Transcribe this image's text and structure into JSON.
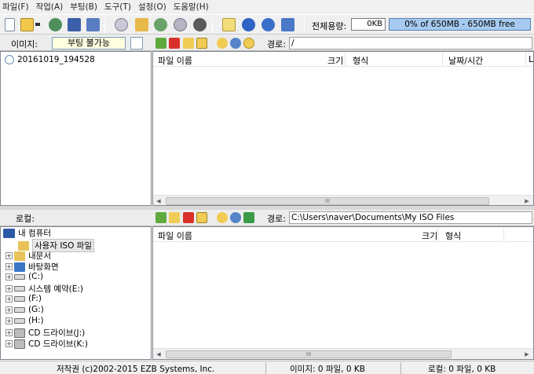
{
  "menu": [
    "파일(F)",
    "작업(A)",
    "부팅(B)",
    "도구(T)",
    "설정(O)",
    "도움말(H)"
  ],
  "capacity": {
    "label": "전체용량:",
    "value": "0KB",
    "bar_text": "0% of 650MB - 650MB free",
    "percent": 0
  },
  "image_panel": {
    "label": "이미지:",
    "boot_status": "부팅 불가능",
    "path_label": "경로:",
    "path": "/",
    "root": "20161019_194528",
    "columns": [
      "파일 이름",
      "크기",
      "형식",
      "날짜/시간",
      "L"
    ]
  },
  "local_panel": {
    "label": "로컬:",
    "path_label": "경로:",
    "path": "C:\\Users\\naver\\Documents\\My ISO Files",
    "columns": [
      "파일 이름",
      "크기",
      "형식"
    ],
    "tree": {
      "root": "내 컴퓨터",
      "items": [
        {
          "label": "사용자 ISO 파일",
          "expandable": false,
          "selected": true,
          "icon": "iso-folder-icon"
        },
        {
          "label": "내문서",
          "expandable": true,
          "selected": false,
          "icon": "documents-folder-icon"
        },
        {
          "label": "바탕화면",
          "expandable": true,
          "selected": false,
          "icon": "desktop-icon"
        },
        {
          "label": "(C:)",
          "expandable": true,
          "selected": false,
          "icon": "drive-icon"
        },
        {
          "label": "시스템 예약(E:)",
          "expandable": true,
          "selected": false,
          "icon": "drive-icon"
        },
        {
          "label": "(F:)",
          "expandable": true,
          "selected": false,
          "icon": "drive-icon"
        },
        {
          "label": "(G:)",
          "expandable": true,
          "selected": false,
          "icon": "drive-icon"
        },
        {
          "label": "(H:)",
          "expandable": true,
          "selected": false,
          "icon": "drive-icon"
        },
        {
          "label": "CD 드라이브(J:)",
          "expandable": true,
          "selected": false,
          "icon": "cd-drive-icon"
        },
        {
          "label": "CD 드라이브(K:)",
          "expandable": true,
          "selected": false,
          "icon": "cd-drive-icon"
        }
      ]
    }
  },
  "scroll_grip": "III",
  "status": {
    "copyright": "저작권 (c)2002-2015 EZB Systems, Inc.",
    "image_info": "이미지: 0 파일, 0 KB",
    "local_info": "로컬: 0 파일, 0 KB"
  }
}
